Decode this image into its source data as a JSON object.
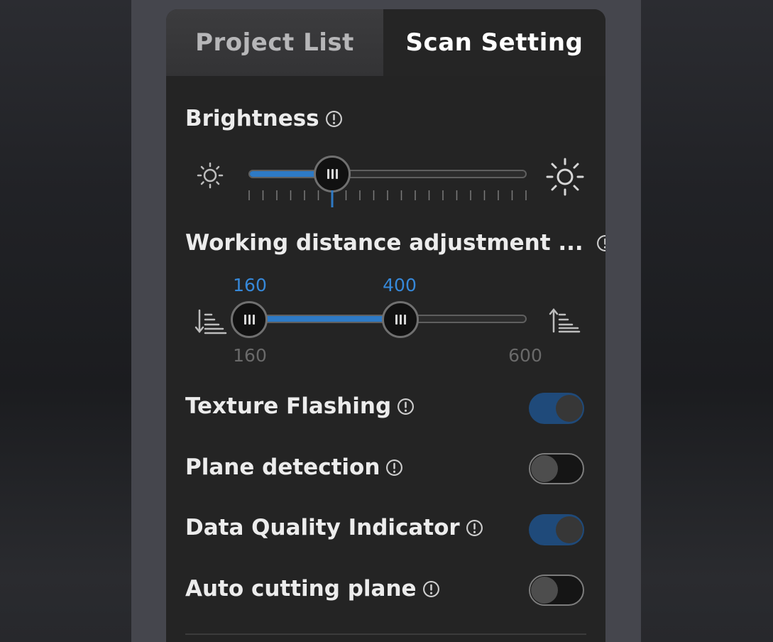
{
  "tabs": {
    "project_list": "Project List",
    "scan_setting": "Scan Setting"
  },
  "brightness": {
    "label": "Brightness",
    "level_percent": 30
  },
  "working_distance": {
    "label": "Working distance adjustment ...",
    "low_value": "160",
    "high_value": "400",
    "min_label": "160",
    "max_label": "600"
  },
  "toggles": {
    "texture_flashing": {
      "label": "Texture Flashing",
      "state": "on"
    },
    "plane_detection": {
      "label": "Plane detection",
      "state": "off"
    },
    "data_quality_indicator": {
      "label": "Data Quality Indicator",
      "state": "on"
    },
    "auto_cutting_plane": {
      "label": "Auto cutting plane",
      "state": "off"
    }
  },
  "colors": {
    "accent": "#2e7ac5",
    "panel_bg": "#242424",
    "text": "#ececec"
  },
  "icons": [
    "info-icon",
    "brightness-low-icon",
    "brightness-high-icon",
    "distance-near-icon",
    "distance-far-icon"
  ]
}
